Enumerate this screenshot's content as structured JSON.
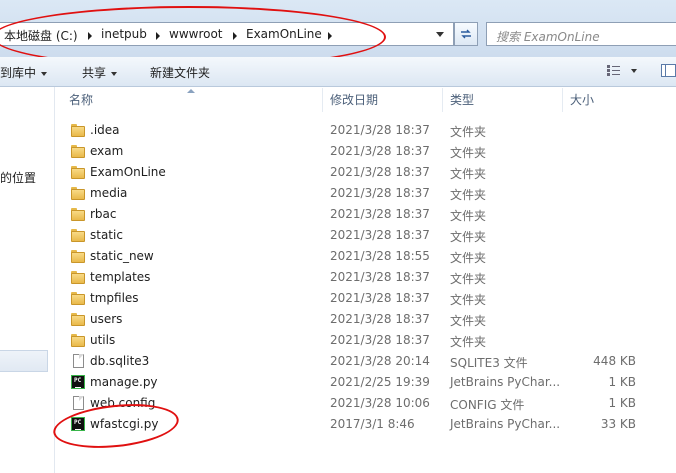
{
  "address_bar": {
    "crumbs": [
      "本地磁盘 (C:)",
      "inetpub",
      "wwwroot",
      "ExamOnLine"
    ]
  },
  "search": {
    "placeholder": "搜索 ExamOnLine"
  },
  "toolbar": {
    "library_label": "到库中",
    "share_label": "共享",
    "new_folder_label": "新建文件夹"
  },
  "nav": {
    "location_fragment": "的位置"
  },
  "columns": {
    "name": "名称",
    "modified": "修改日期",
    "type": "类型",
    "size": "大小"
  },
  "files": [
    {
      "icon": "folder-icon",
      "name": ".idea",
      "modified": "2021/3/28 18:37",
      "type": "文件夹",
      "size": ""
    },
    {
      "icon": "folder-icon",
      "name": "exam",
      "modified": "2021/3/28 18:37",
      "type": "文件夹",
      "size": ""
    },
    {
      "icon": "folder-icon",
      "name": "ExamOnLine",
      "modified": "2021/3/28 18:37",
      "type": "文件夹",
      "size": ""
    },
    {
      "icon": "folder-icon",
      "name": "media",
      "modified": "2021/3/28 18:37",
      "type": "文件夹",
      "size": ""
    },
    {
      "icon": "folder-icon",
      "name": "rbac",
      "modified": "2021/3/28 18:37",
      "type": "文件夹",
      "size": ""
    },
    {
      "icon": "folder-icon",
      "name": "static",
      "modified": "2021/3/28 18:37",
      "type": "文件夹",
      "size": ""
    },
    {
      "icon": "folder-icon",
      "name": "static_new",
      "modified": "2021/3/28 18:55",
      "type": "文件夹",
      "size": ""
    },
    {
      "icon": "folder-icon",
      "name": "templates",
      "modified": "2021/3/28 18:37",
      "type": "文件夹",
      "size": ""
    },
    {
      "icon": "folder-icon",
      "name": "tmpfiles",
      "modified": "2021/3/28 18:37",
      "type": "文件夹",
      "size": ""
    },
    {
      "icon": "folder-icon",
      "name": "users",
      "modified": "2021/3/28 18:37",
      "type": "文件夹",
      "size": ""
    },
    {
      "icon": "folder-icon",
      "name": "utils",
      "modified": "2021/3/28 18:37",
      "type": "文件夹",
      "size": ""
    },
    {
      "icon": "file-icon",
      "name": "db.sqlite3",
      "modified": "2021/3/28 20:14",
      "type": "SQLITE3 文件",
      "size": "448 KB"
    },
    {
      "icon": "pycharm-icon",
      "name": "manage.py",
      "modified": "2021/2/25 19:39",
      "type": "JetBrains PyChar...",
      "size": "1 KB"
    },
    {
      "icon": "file-icon",
      "name": "web.config",
      "modified": "2021/3/28 10:06",
      "type": "CONFIG 文件",
      "size": "1 KB"
    },
    {
      "icon": "pycharm-icon",
      "name": "wfastcgi.py",
      "modified": "2017/3/1 8:46",
      "type": "JetBrains PyChar...",
      "size": "33 KB"
    }
  ],
  "colors": {
    "annotation": "#e01010",
    "chrome": "#dbe8f5"
  }
}
